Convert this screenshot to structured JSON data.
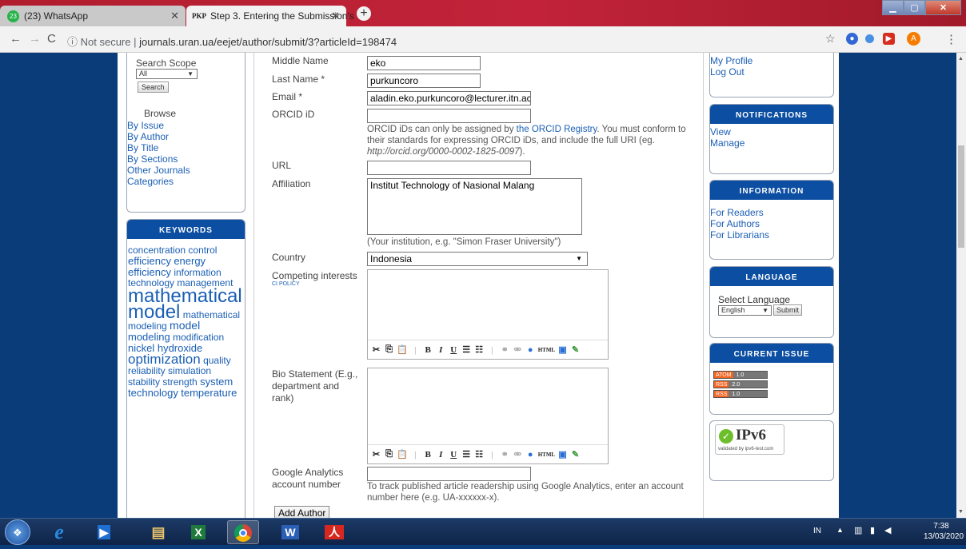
{
  "browser": {
    "tabs": [
      {
        "label": "(23) WhatsApp",
        "favicon": "23"
      },
      {
        "label": "Step 3. Entering the Submission's",
        "favicon": "PKP"
      }
    ],
    "url_security": "Not secure",
    "url_text": "journals.uran.ua/eejet/author/submit/3?articleId=198474",
    "profile_initial": "A"
  },
  "left_sidebar": {
    "search_scope_label": "Search Scope",
    "search_scope_value": "All",
    "search_button": "Search",
    "browse_heading": "Browse",
    "browse_links": [
      "By Issue",
      "By Author",
      "By Title",
      "By Sections",
      "Other Journals",
      "Categories"
    ],
    "keywords_title": "KEYWORDS",
    "keywords": [
      {
        "text": "concentration",
        "size": 12
      },
      {
        "text": "control",
        "size": 12
      },
      {
        "text": "efficiency",
        "size": 13
      },
      {
        "text": "energy efficiency",
        "size": 13
      },
      {
        "text": "information",
        "size": 12
      },
      {
        "text": "technology",
        "size": 12
      },
      {
        "text": "management",
        "size": 12
      },
      {
        "text": "mathematical model",
        "size": 24
      },
      {
        "text": "mathematical modeling",
        "size": 12
      },
      {
        "text": "model",
        "size": 14
      },
      {
        "text": "modeling",
        "size": 13
      },
      {
        "text": "modification",
        "size": 12
      },
      {
        "text": "nickel hydroxide",
        "size": 13
      },
      {
        "text": "optimization",
        "size": 17
      },
      {
        "text": "quality",
        "size": 12
      },
      {
        "text": "reliability",
        "size": 12
      },
      {
        "text": "simulation",
        "size": 12
      },
      {
        "text": "stability",
        "size": 12
      },
      {
        "text": "strength",
        "size": 12
      },
      {
        "text": "system",
        "size": 13
      },
      {
        "text": "technology",
        "size": 13
      },
      {
        "text": "temperature",
        "size": 13
      }
    ]
  },
  "form": {
    "middle_name_label": "Middle Name",
    "middle_name_value": "eko",
    "last_name_label": "Last Name *",
    "last_name_value": "purkuncoro",
    "email_label": "Email *",
    "email_value": "aladin.eko.purkuncoro@lecturer.itn.ac",
    "orcid_label": "ORCID iD",
    "orcid_value": "",
    "orcid_help_1": "ORCID iDs can only be assigned by",
    "orcid_help_link": "the ORCID Registry",
    "orcid_help_2": ". You must conform to their standards for expressing ORCID iDs, and include the full URI (eg.",
    "orcid_help_example": "http://orcid.org/0000-0002-1825-0097",
    "orcid_help_end": ").",
    "url_label": "URL",
    "url_value": "",
    "affiliation_label": "Affiliation",
    "affiliation_value": "Institut Technology of Nasional Malang",
    "affiliation_help": "(Your institution, e.g. \"Simon Fraser University\")",
    "country_label": "Country",
    "country_value": "Indonesia",
    "competing_label": "Competing interests",
    "competing_policy": "CI POLICY",
    "bio_label": "Bio Statement (E.g., department and rank)",
    "ga_label": "Google Analytics account number",
    "ga_value": "",
    "ga_help": "To track published article readership using Google Analytics, enter an account number here (e.g. UA-xxxxxx-x).",
    "add_author_button": "Add Author"
  },
  "editor_toolbar": [
    "cut",
    "copy",
    "paste",
    "B",
    "I",
    "U",
    "bullets",
    "numbered",
    "link",
    "unlink",
    "help",
    "HTML",
    "image",
    "fullscreen"
  ],
  "right_sidebar": {
    "user_links": [
      "My Profile",
      "Log Out"
    ],
    "notifications_title": "NOTIFICATIONS",
    "notifications_links": [
      "View",
      "Manage"
    ],
    "information_title": "INFORMATION",
    "information_links": [
      "For Readers",
      "For Authors",
      "For Librarians"
    ],
    "language_title": "LANGUAGE",
    "select_language_label": "Select Language",
    "language_value": "English",
    "language_submit": "Submit",
    "current_issue_title": "CURRENT ISSUE",
    "feeds": [
      {
        "tag": "ATOM",
        "version": "1.0"
      },
      {
        "tag": "RSS",
        "version": "2.0"
      },
      {
        "tag": "RSS",
        "version": "1.0"
      }
    ],
    "ipv6_text": "IPv6",
    "ipv6_sub": "validated by ipv6-test.com"
  },
  "taskbar": {
    "lang": "IN",
    "time": "7:38",
    "date": "13/03/2020"
  }
}
